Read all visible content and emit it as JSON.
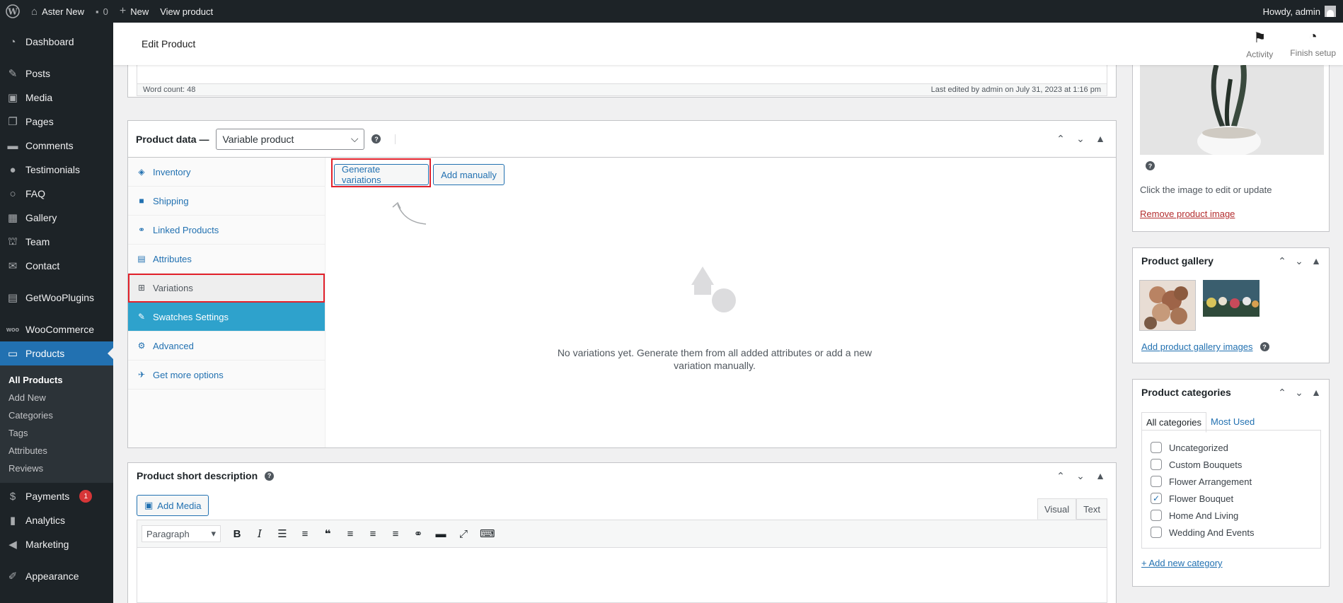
{
  "adminbar": {
    "site_name": "Aster New",
    "comments_count": "0",
    "new_label": "New",
    "view_product": "View product",
    "howdy": "Howdy, admin"
  },
  "sidebar": {
    "dashboard": "Dashboard",
    "posts": "Posts",
    "media": "Media",
    "pages": "Pages",
    "comments": "Comments",
    "testimonials": "Testimonials",
    "faq": "FAQ",
    "gallery": "Gallery",
    "team": "Team",
    "contact": "Contact",
    "getwooplugins": "GetWooPlugins",
    "woocommerce": "WooCommerce",
    "products": "Products",
    "submenu": [
      "All Products",
      "Add New",
      "Categories",
      "Tags",
      "Attributes",
      "Reviews"
    ],
    "payments": "Payments",
    "payments_badge": "1",
    "analytics": "Analytics",
    "marketing": "Marketing",
    "appearance": "Appearance"
  },
  "header": {
    "title": "Edit Product",
    "activity": "Activity",
    "finish_setup": "Finish setup"
  },
  "editor": {
    "word_count": "Word count: 48",
    "last_edited": "Last edited by admin on July 31, 2023 at 1:16 pm"
  },
  "product_data": {
    "label": "Product data —",
    "product_type": "Variable product",
    "tabs": [
      "Inventory",
      "Shipping",
      "Linked Products",
      "Attributes",
      "Variations",
      "Swatches Settings",
      "Advanced",
      "Get more options"
    ],
    "generate_btn": "Generate variations",
    "add_manually_btn": "Add manually",
    "empty_msg": "No variations yet. Generate them from all added attributes or add a new variation manually."
  },
  "short_desc": {
    "title": "Product short description",
    "add_media": "Add Media",
    "visual_tab": "Visual",
    "text_tab": "Text",
    "format": "Paragraph"
  },
  "product_image": {
    "hint": "Click the image to edit or update",
    "remove": "Remove product image"
  },
  "gallery": {
    "title": "Product gallery",
    "add": "Add product gallery images"
  },
  "categories": {
    "title": "Product categories",
    "tab_all": "All categories",
    "tab_most": "Most Used",
    "items": [
      "Uncategorized",
      "Custom Bouquets",
      "Flower Arrangement",
      "Flower Bouquet",
      "Home And Living",
      "Wedding And Events"
    ],
    "add_new": "+ Add new category"
  },
  "colors": {
    "admin_dark": "#1d2327",
    "accent": "#2271b1",
    "highlight": "#e2212b",
    "swatches": "#2ea2cc"
  }
}
